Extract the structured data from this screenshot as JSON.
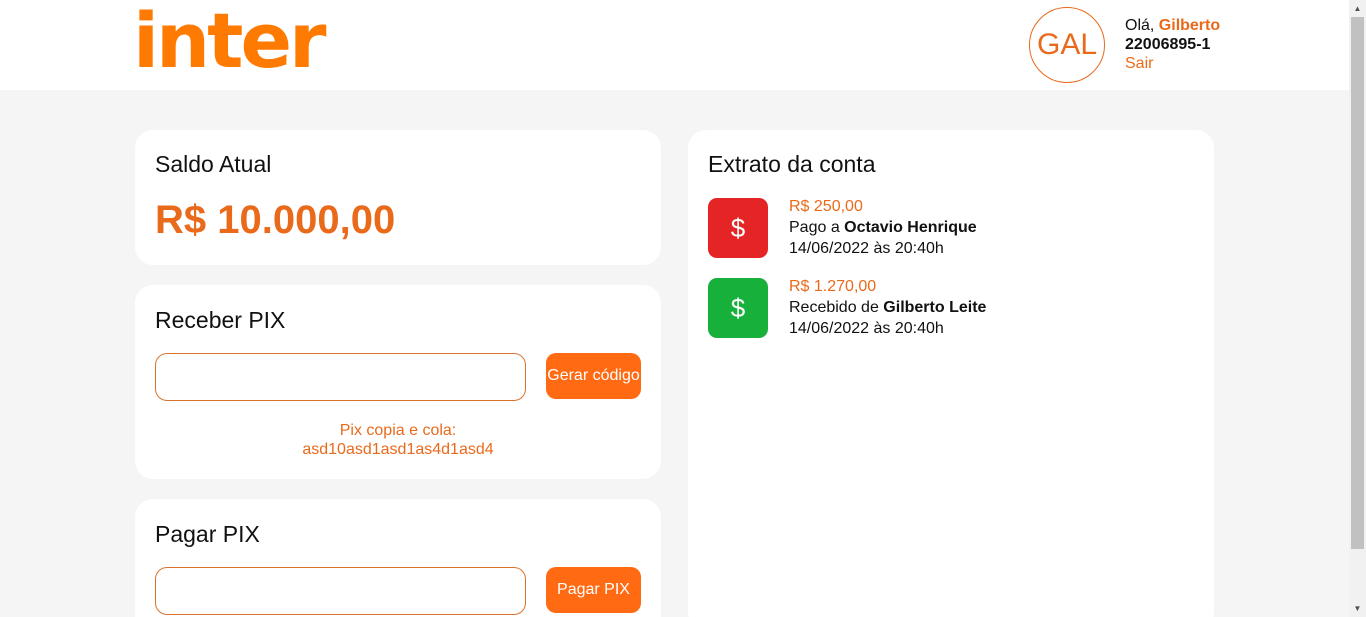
{
  "header": {
    "logo": "inter",
    "avatar_initials": "GAL",
    "greeting_prefix": "Olá, ",
    "user_name": "Gilberto",
    "account_number": "22006895-1",
    "logout_label": "Sair"
  },
  "balance": {
    "title": "Saldo Atual",
    "amount": "R$ 10.000,00"
  },
  "receive_pix": {
    "title": "Receber PIX",
    "input_value": "",
    "button_label": "Gerar código",
    "copy_label": "Pix copia e cola:",
    "copy_code": "asd10asd1asd1as4d1asd4"
  },
  "pay_pix": {
    "title": "Pagar PIX",
    "input_value": "",
    "button_label": "Pagar PIX"
  },
  "statement": {
    "title": "Extrato da conta",
    "transactions": [
      {
        "icon": "dollar-icon",
        "color": "#e52525",
        "amount": "R$ 250,00",
        "description_prefix": "Pago a ",
        "party": "Octavio Henrique",
        "datetime": "14/06/2022 às 20:40h"
      },
      {
        "icon": "dollar-icon",
        "color": "#17b03a",
        "amount": "R$ 1.270,00",
        "description_prefix": "Recebido de ",
        "party": "Gilberto Leite",
        "datetime": "14/06/2022 às 20:40h"
      }
    ]
  },
  "colors": {
    "brand": "#ff7a00",
    "accent": "#ea6a1c",
    "button": "#ff6a13",
    "debit": "#e52525",
    "credit": "#17b03a"
  }
}
